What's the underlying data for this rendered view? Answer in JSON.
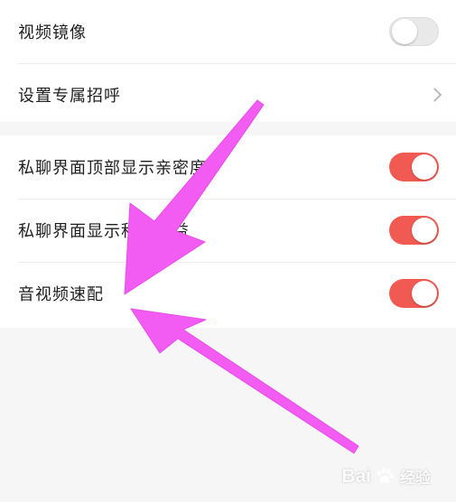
{
  "settings_group_1": [
    {
      "label": "视频镜像",
      "control": "toggle",
      "state": "off"
    },
    {
      "label": "设置专属招呼",
      "control": "chevron"
    }
  ],
  "settings_group_2": [
    {
      "label": "私聊界面顶部显示亲密度",
      "control": "toggle",
      "state": "on"
    },
    {
      "label": "私聊界面显示积分收益",
      "control": "toggle",
      "state": "on"
    },
    {
      "label": "音视频速配",
      "control": "toggle",
      "state": "on"
    }
  ],
  "colors": {
    "toggle_on": "#f15a52",
    "toggle_off": "#e9e9e9",
    "arrow": "#f25cf2",
    "page_bg": "#f6f6f6"
  },
  "watermark": {
    "brand_prefix": "Bai",
    "brand_suffix": "经验",
    "paw_icon": "paw-icon"
  }
}
